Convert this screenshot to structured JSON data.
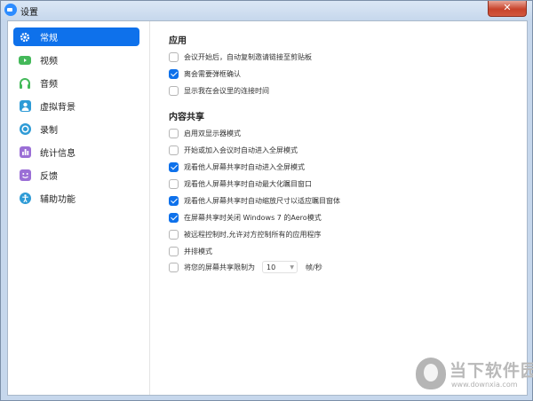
{
  "window": {
    "title": "设置",
    "close_glyph": "✕"
  },
  "colors": {
    "accent": "#0e71eb",
    "close": "#c7432b"
  },
  "sidebar": {
    "items": [
      {
        "label": "常规",
        "icon": "gear-icon",
        "active": true
      },
      {
        "label": "视频",
        "icon": "video-icon"
      },
      {
        "label": "音频",
        "icon": "headphones-icon"
      },
      {
        "label": "虚拟背景",
        "icon": "person-background-icon"
      },
      {
        "label": "录制",
        "icon": "record-icon"
      },
      {
        "label": "统计信息",
        "icon": "bar-chart-icon"
      },
      {
        "label": "反馈",
        "icon": "smiley-icon"
      },
      {
        "label": "辅助功能",
        "icon": "accessibility-icon"
      }
    ]
  },
  "sections": {
    "app": {
      "title": "应用",
      "options": [
        {
          "label": "会议开始后，自动复制邀请链接至剪贴板",
          "checked": false
        },
        {
          "label": "离会需要弹框确认",
          "checked": true
        },
        {
          "label": "显示我在会议里的连接时间",
          "checked": false
        }
      ]
    },
    "share": {
      "title": "内容共享",
      "options": [
        {
          "label": "启用双显示器模式",
          "checked": false
        },
        {
          "label": "开始或加入会议时自动进入全屏模式",
          "checked": false
        },
        {
          "label": "观看他人屏幕共享时自动进入全屏模式",
          "checked": true
        },
        {
          "label": "观看他人屏幕共享时自动最大化瞩目窗口",
          "checked": false
        },
        {
          "label": "观看他人屏幕共享时自动缩放尺寸以适应瞩目窗体",
          "checked": true
        },
        {
          "label": "在屏幕共享时关闭 Windows 7 的Aero模式",
          "checked": true
        },
        {
          "label": "被远程控制时,允许对方控制所有的应用程序",
          "checked": false
        },
        {
          "label": "并排模式",
          "checked": false
        }
      ],
      "limit": {
        "label": "将您的屏幕共享限制为",
        "checked": false,
        "value": "10",
        "unit": "帧/秒"
      }
    }
  },
  "watermark": {
    "name": "当下软件园",
    "url": "www.downxia.com"
  }
}
